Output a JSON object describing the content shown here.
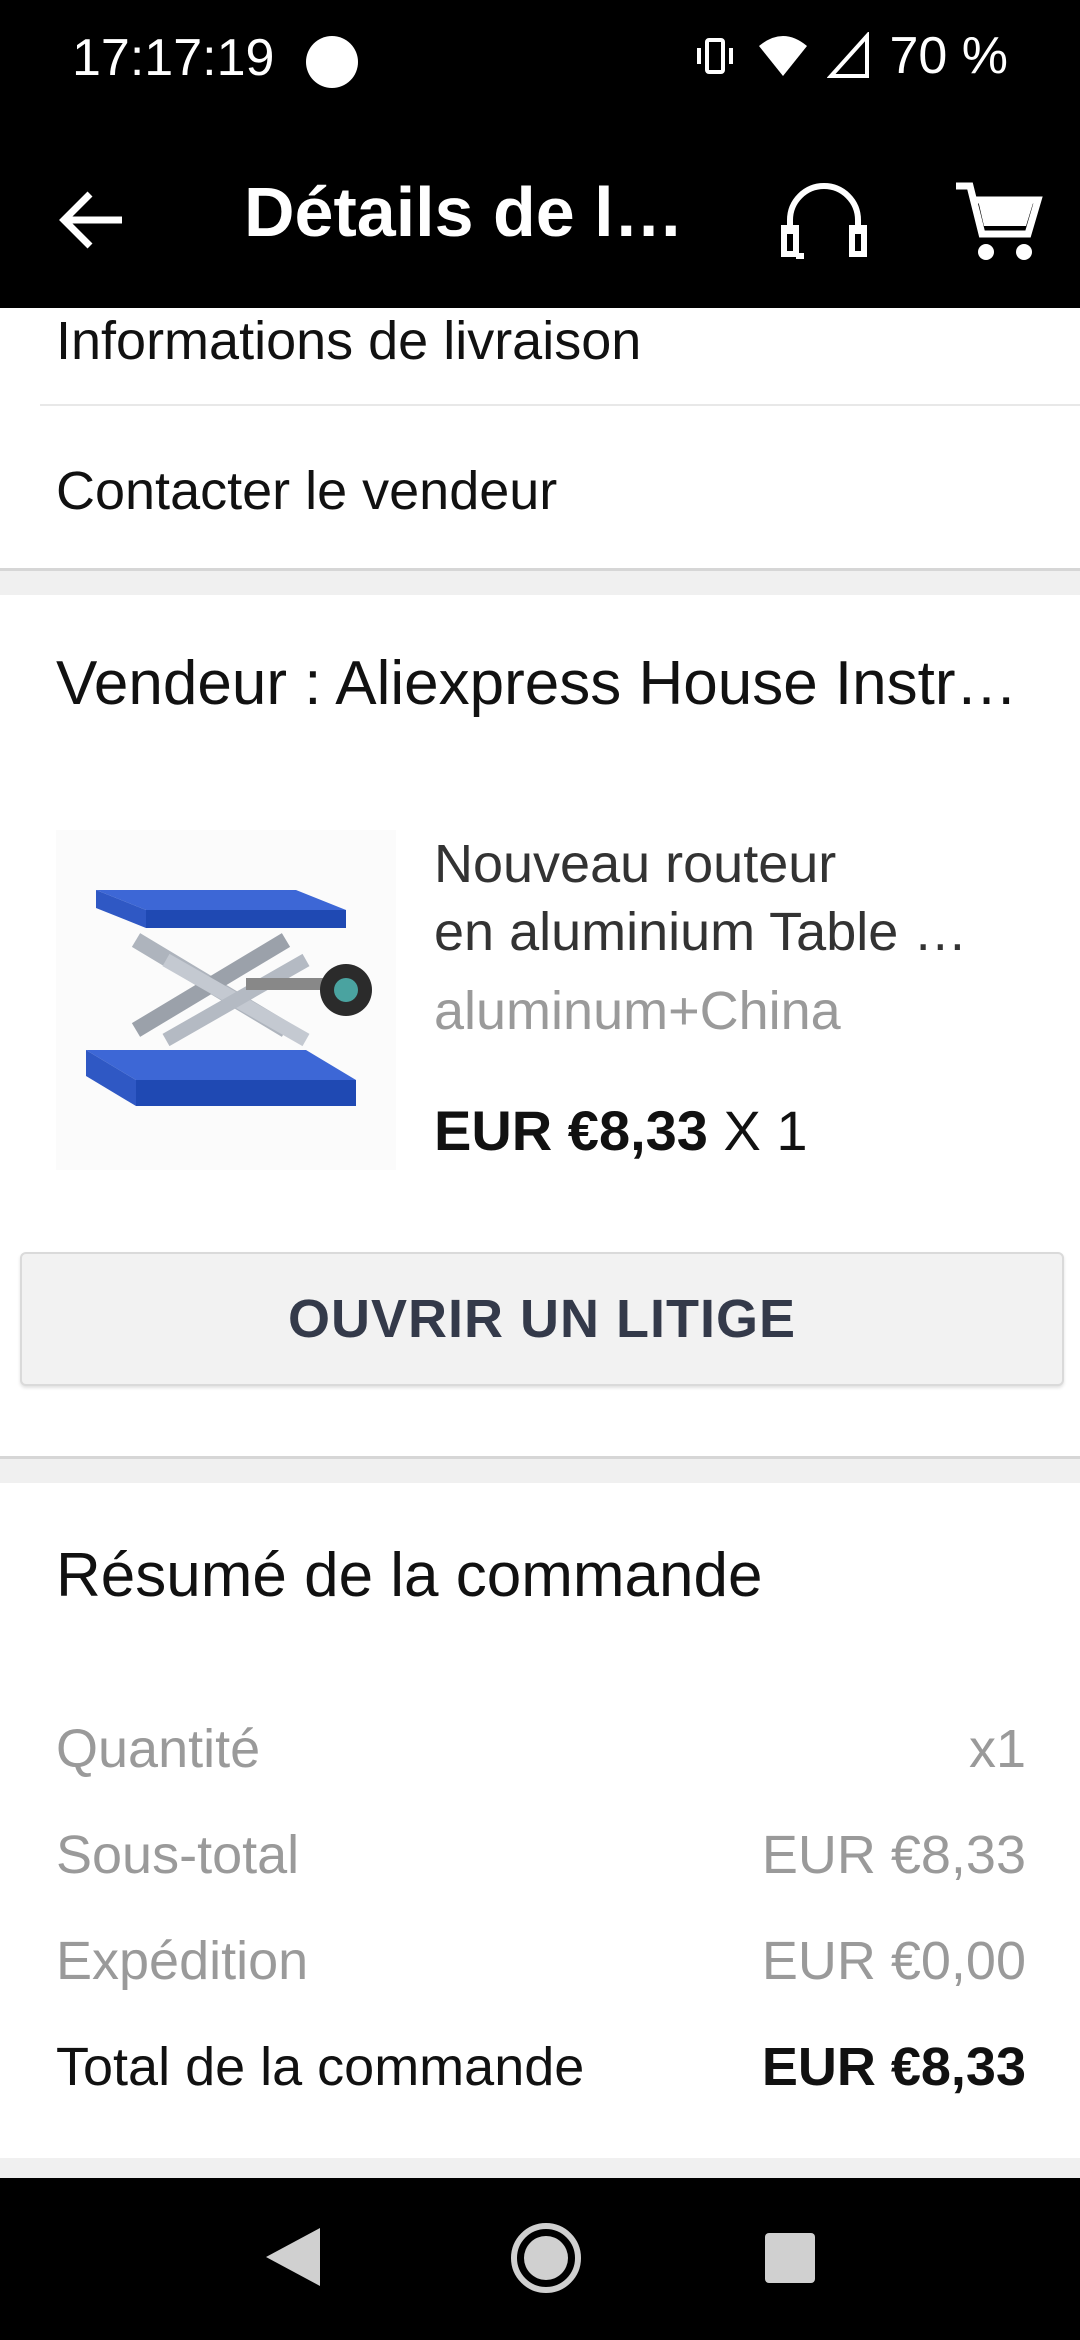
{
  "status_bar": {
    "time": "17:17:19",
    "battery": "70 %",
    "icons": [
      "vibrate-icon",
      "wifi-icon",
      "signal-icon"
    ]
  },
  "toolbar": {
    "title": "Détails de l…",
    "icons": [
      "back-arrow-icon",
      "headset-icon",
      "cart-icon"
    ]
  },
  "menu": {
    "delivery_info": "Informations de livraison",
    "contact_seller": "Contacter le vendeur"
  },
  "seller": {
    "label": "Vendeur : Aliexpress House Instr…"
  },
  "product": {
    "title_line1": "Nouveau routeur",
    "title_line2": "en aluminium Table …",
    "variant": "aluminum+China",
    "price": "EUR €8,33",
    "quantity": " X 1",
    "image_icon": "lab-jack-image"
  },
  "actions": {
    "dispute": "OUVRIR UN LITIGE"
  },
  "summary": {
    "title": "Résumé de la commande",
    "rows": [
      {
        "label": "Quantité",
        "value": "x1"
      },
      {
        "label": "Sous-total",
        "value": "EUR €8,33"
      },
      {
        "label": "Expédition",
        "value": "EUR €0,00"
      },
      {
        "label": "Total de la commande",
        "value": "EUR €8,33"
      }
    ]
  },
  "colors": {
    "bar_background": "#000000",
    "button_background": "#f2f2f2",
    "button_text": "#343a4a",
    "muted_text": "#9a9a9a"
  }
}
